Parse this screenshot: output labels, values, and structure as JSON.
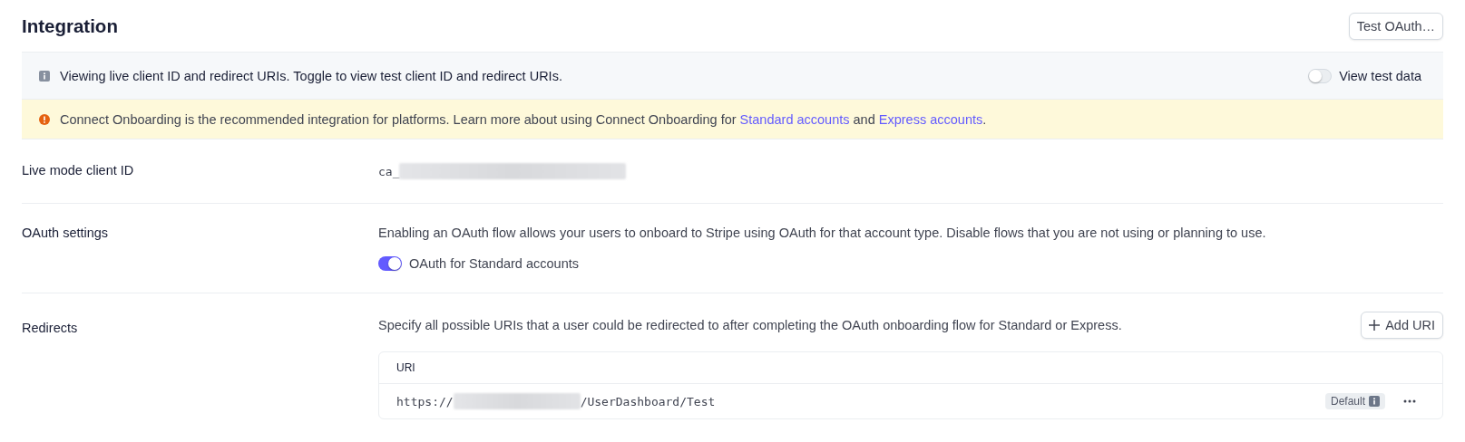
{
  "header": {
    "title": "Integration",
    "button": "Test OAuth…"
  },
  "banners": [
    {
      "kind": "info",
      "text": "Viewing live client ID and redirect URIs. Toggle to view test client ID and redirect URIs.",
      "toggle": {
        "label": "View test data",
        "on": false
      }
    },
    {
      "kind": "warning",
      "parts": [
        {
          "text": "Connect Onboarding is the recommended integration for platforms. Learn more about using Connect Onboarding for "
        },
        {
          "text": "Standard accounts",
          "link": true
        },
        {
          "text": " and "
        },
        {
          "text": "Express accounts",
          "link": true
        },
        {
          "text": "."
        }
      ]
    }
  ],
  "client_id": {
    "label": "Live mode client ID",
    "prefix": "ca_"
  },
  "oauth": {
    "label": "OAuth settings",
    "description": "Enabling an OAuth flow allows your users to onboard to Stripe using OAuth for that account type. Disable flows that you are not using or planning to use.",
    "toggles": [
      {
        "label": "OAuth for Standard accounts",
        "on": true
      }
    ]
  },
  "redirects": {
    "label": "Redirects",
    "description": "Specify all possible URIs that a user could be redirected to after completing the OAuth onboarding flow for Standard or Express.",
    "button": "Add URI",
    "table": {
      "columns": [
        "URI"
      ],
      "rows": [
        {
          "prefix": "https://",
          "suffix": "/UserDashboard/Test",
          "badge": "Default"
        }
      ]
    }
  }
}
